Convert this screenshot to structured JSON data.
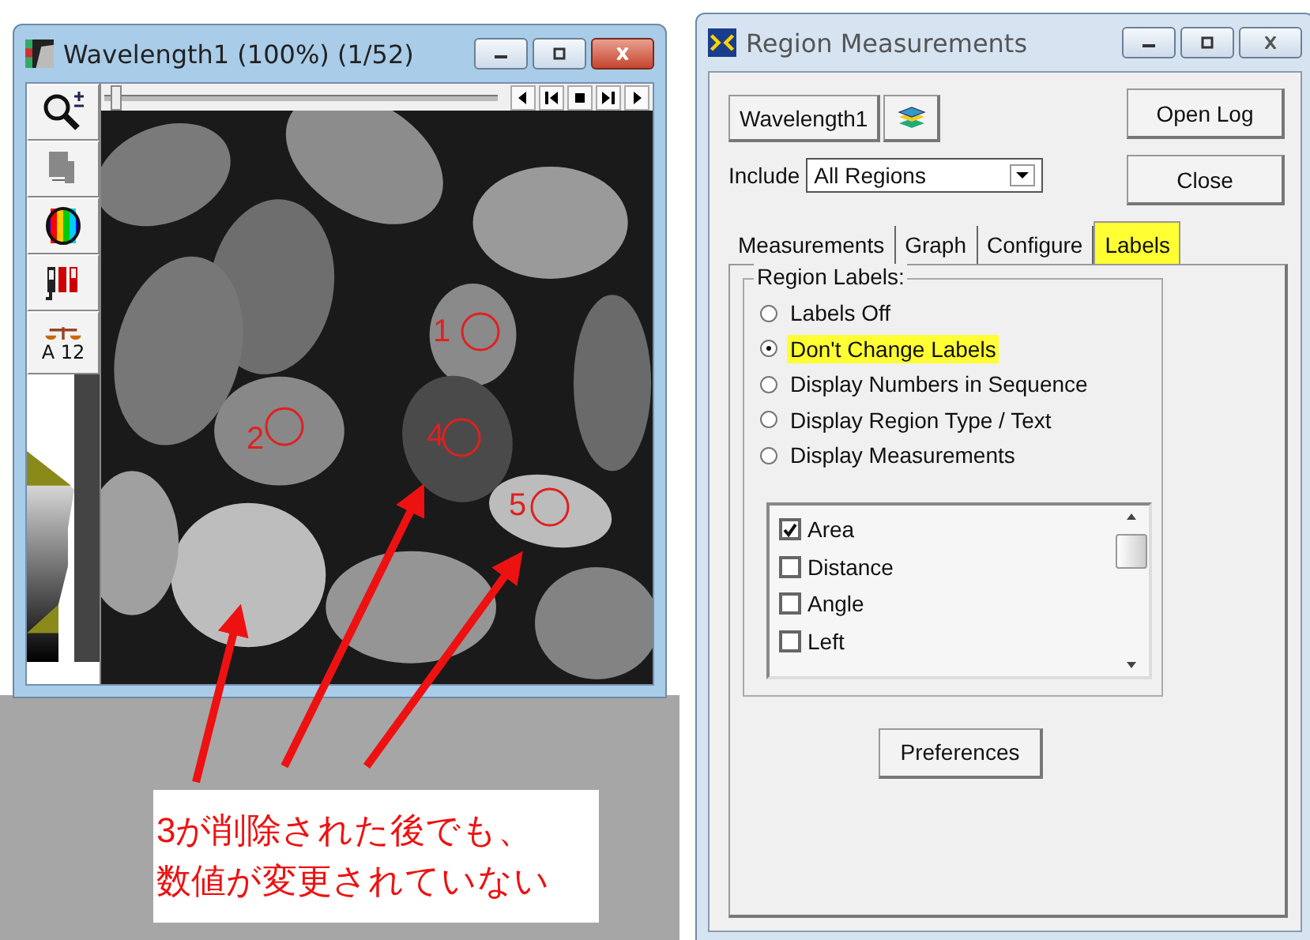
{
  "image_window": {
    "title": "Wavelength1 (100%) (1/52)",
    "active": true,
    "slider": {
      "level": 0
    },
    "scale_label": "A 12",
    "regions": [
      {
        "label": "1"
      },
      {
        "label": "2"
      },
      {
        "label": "4"
      },
      {
        "label": "5"
      }
    ]
  },
  "callout": {
    "lines": [
      "3が削除された後でも、",
      "数値が変更されていない"
    ]
  },
  "measure_window": {
    "title": "Region Measurements",
    "active": false,
    "source_button": "Wavelength1",
    "open_log": "Open Log",
    "include_label": "Include",
    "include_value": "All Regions",
    "close": "Close",
    "tabs": [
      {
        "label": "Measurements",
        "selected": false,
        "highlighted": false
      },
      {
        "label": "Graph",
        "selected": false,
        "highlighted": false
      },
      {
        "label": "Configure",
        "selected": false,
        "highlighted": false
      },
      {
        "label": "Labels",
        "selected": true,
        "highlighted": true
      }
    ],
    "group_title": "Region Labels:",
    "radios": [
      {
        "label": "Labels Off",
        "selected": false,
        "highlighted": false
      },
      {
        "label": "Don't Change Labels",
        "selected": true,
        "highlighted": true
      },
      {
        "label": "Display Numbers in Sequence",
        "selected": false,
        "highlighted": false
      },
      {
        "label": "Display Region Type / Text",
        "selected": false,
        "highlighted": false
      },
      {
        "label": "Display Measurements",
        "selected": false,
        "highlighted": false
      }
    ],
    "list": [
      {
        "label": "Area",
        "checked": true
      },
      {
        "label": "Distance",
        "checked": false
      },
      {
        "label": "Angle",
        "checked": false
      },
      {
        "label": "Left",
        "checked": false
      }
    ],
    "preferences": "Preferences"
  }
}
